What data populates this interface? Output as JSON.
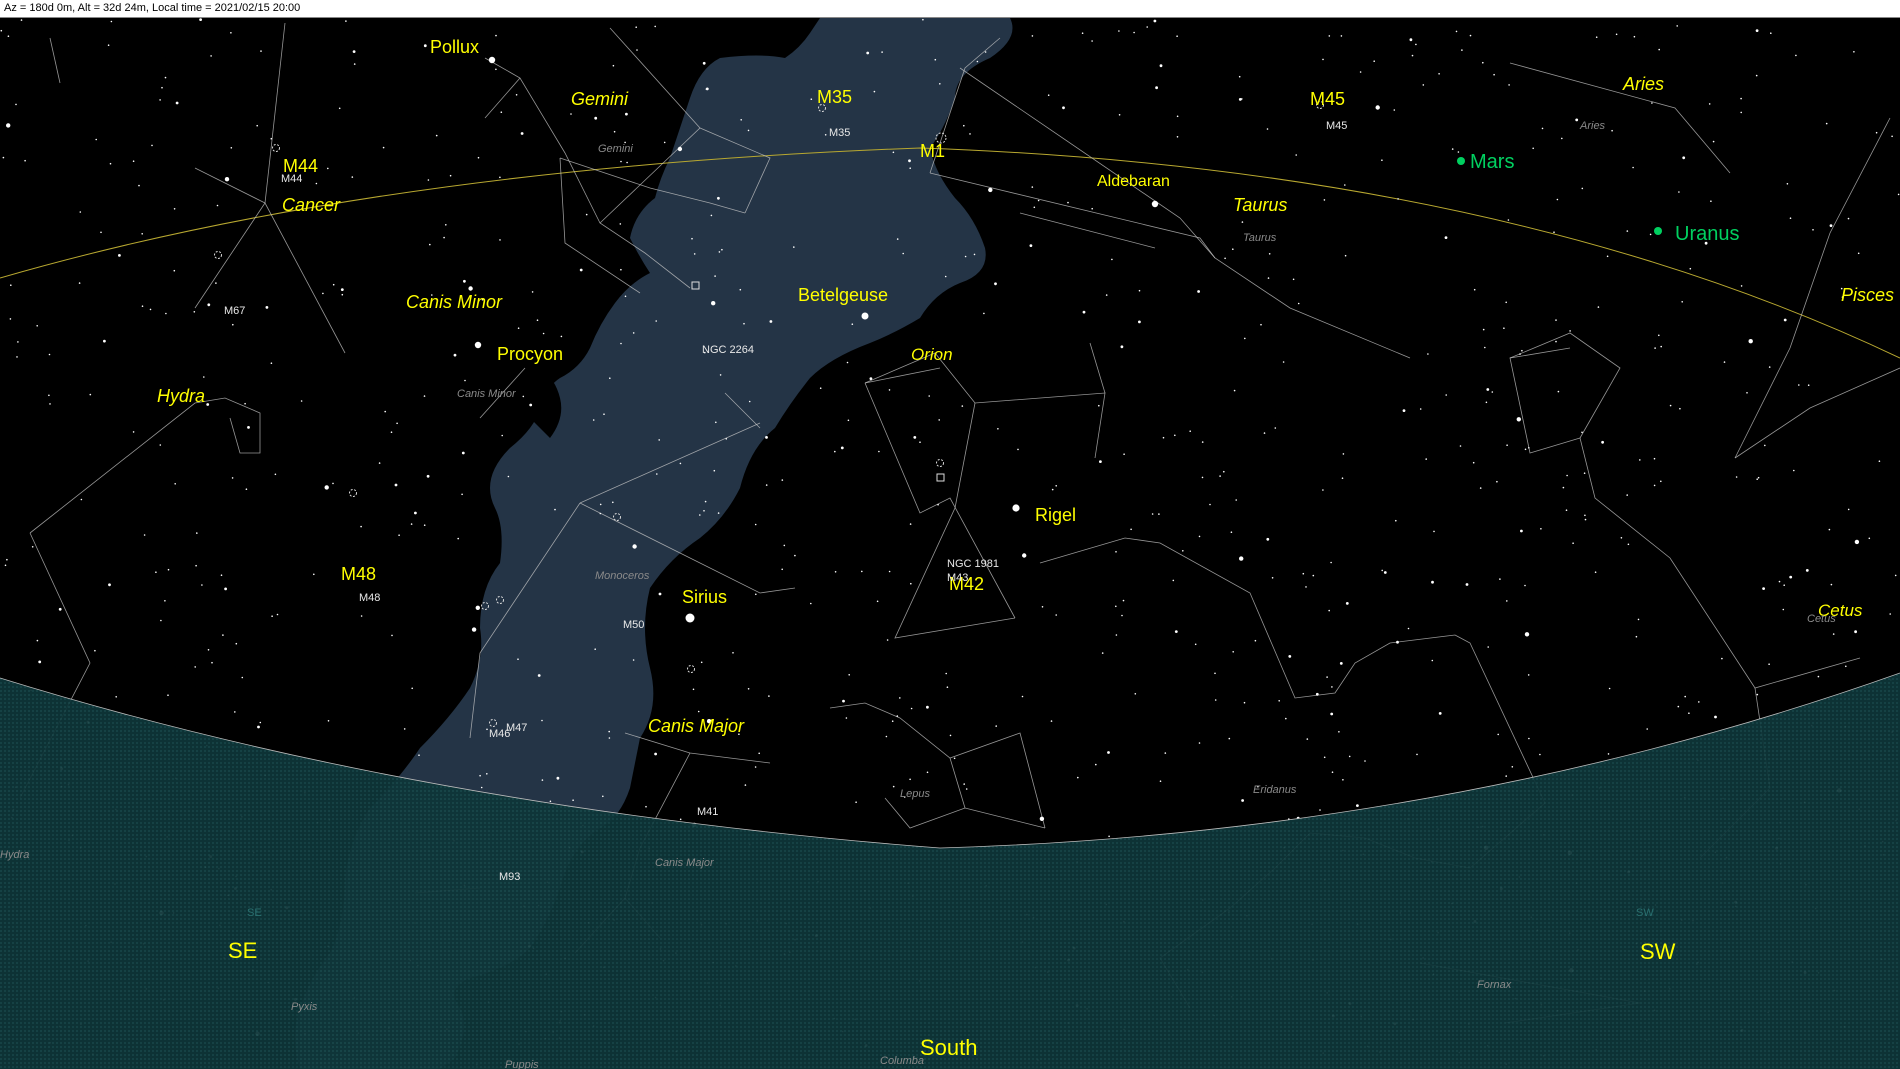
{
  "status_bar": {
    "text": "Az = 180d 0m, Alt = 32d 24m, Local time = 2021/02/15 20:00"
  },
  "colors": {
    "sky": "#000000",
    "milky_way": "#243446",
    "horizon_fill": "#0f3a3d",
    "ecliptic": "#b8a830",
    "labels": "#ffff00",
    "planets": "#00d060"
  },
  "bright_stars": [
    {
      "name": "Pollux"
    },
    {
      "name": "Procyon"
    },
    {
      "name": "Betelgeuse"
    },
    {
      "name": "Aldebaran"
    },
    {
      "name": "Rigel"
    },
    {
      "name": "Sirius"
    }
  ],
  "constellations_major": [
    "Gemini",
    "Cancer",
    "Canis Minor",
    "Hydra",
    "Orion",
    "Taurus",
    "Aries",
    "Pisces",
    "Cetus",
    "Canis Major"
  ],
  "constellations_minor": [
    "Gemini",
    "Canis Minor",
    "Monoceros",
    "Taurus",
    "Aries",
    "Cetus",
    "Lepus",
    "Canis Major",
    "Eridanus",
    "Fornax",
    "Pyxis",
    "Columba",
    "Puppis",
    "Hydra"
  ],
  "messier_major": [
    "M35",
    "M1",
    "M44",
    "M45",
    "M48",
    "M42"
  ],
  "dso_small": [
    "M35",
    "M44",
    "M45",
    "M67",
    "NGC 2264",
    "M48",
    "M50",
    "M47",
    "M46",
    "M41",
    "M93",
    "NGC 1981",
    "M43"
  ],
  "planets": [
    {
      "name": "Mars"
    },
    {
      "name": "Uranus"
    }
  ],
  "compass": {
    "se": "SE",
    "south": "South",
    "sw": "SW",
    "se_small": "SE",
    "sw_small": "SW"
  }
}
